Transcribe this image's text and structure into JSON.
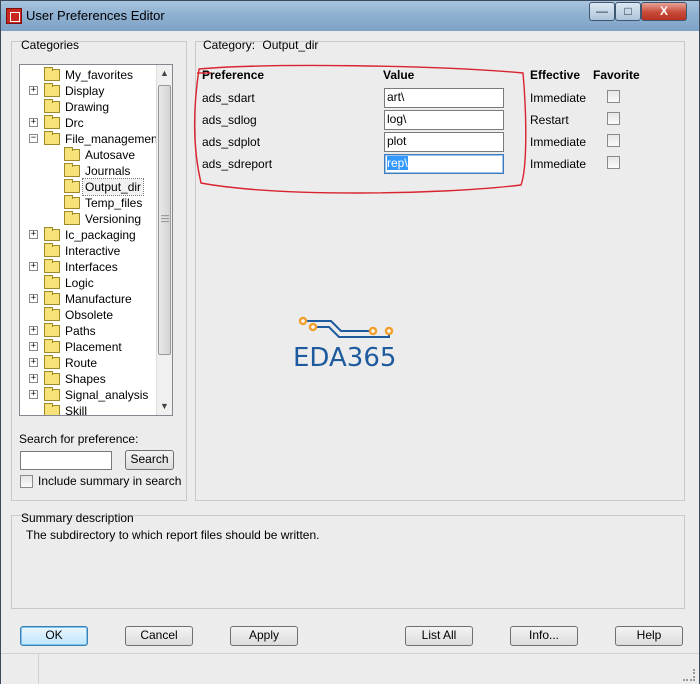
{
  "window": {
    "title": "User Preferences Editor",
    "min": "—",
    "max": "□",
    "close": "X"
  },
  "categories": {
    "label": "Categories",
    "items": [
      {
        "label": "My_favorites",
        "expander": "",
        "level": 0
      },
      {
        "label": "Display",
        "expander": "+",
        "level": 0
      },
      {
        "label": "Drawing",
        "expander": "",
        "level": 0
      },
      {
        "label": "Drc",
        "expander": "+",
        "level": 0
      },
      {
        "label": "File_management",
        "expander": "−",
        "level": 0
      },
      {
        "label": "Autosave",
        "expander": "",
        "level": 1
      },
      {
        "label": "Journals",
        "expander": "",
        "level": 1
      },
      {
        "label": "Output_dir",
        "expander": "",
        "level": 1,
        "selected": true
      },
      {
        "label": "Temp_files",
        "expander": "",
        "level": 1
      },
      {
        "label": "Versioning",
        "expander": "",
        "level": 1
      },
      {
        "label": "Ic_packaging",
        "expander": "+",
        "level": 0
      },
      {
        "label": "Interactive",
        "expander": "",
        "level": 0
      },
      {
        "label": "Interfaces",
        "expander": "+",
        "level": 0
      },
      {
        "label": "Logic",
        "expander": "",
        "level": 0
      },
      {
        "label": "Manufacture",
        "expander": "+",
        "level": 0
      },
      {
        "label": "Obsolete",
        "expander": "",
        "level": 0
      },
      {
        "label": "Paths",
        "expander": "+",
        "level": 0
      },
      {
        "label": "Placement",
        "expander": "+",
        "level": 0
      },
      {
        "label": "Route",
        "expander": "+",
        "level": 0
      },
      {
        "label": "Shapes",
        "expander": "+",
        "level": 0
      },
      {
        "label": "Signal_analysis",
        "expander": "+",
        "level": 0
      },
      {
        "label": "Skill",
        "expander": "",
        "level": 0
      }
    ]
  },
  "search": {
    "label": "Search for preference:",
    "value": "",
    "button": "Search",
    "include_summary": "Include summary in search"
  },
  "category_header": {
    "prefix": "Category:",
    "name": "Output_dir"
  },
  "columns": {
    "preference": "Preference",
    "value": "Value",
    "effective": "Effective",
    "favorite": "Favorite"
  },
  "rows": [
    {
      "name": "ads_sdart",
      "value": "art\\",
      "effective": "Immediate"
    },
    {
      "name": "ads_sdlog",
      "value": "log\\",
      "effective": "Restart"
    },
    {
      "name": "ads_sdplot",
      "value": "plot",
      "effective": "Immediate"
    },
    {
      "name": "ads_sdreport",
      "value": "rep\\",
      "effective": "Immediate"
    }
  ],
  "watermark": {
    "text": "EDA365"
  },
  "annotation_color": "#d9232e",
  "summary": {
    "label": "Summary description",
    "text": "The subdirectory to which report files should be written."
  },
  "buttons": {
    "ok": "OK",
    "cancel": "Cancel",
    "apply": "Apply",
    "list_all": "List All",
    "info": "Info...",
    "help": "Help"
  }
}
